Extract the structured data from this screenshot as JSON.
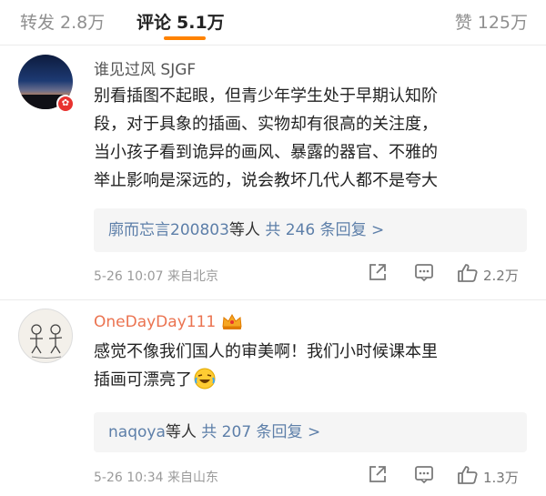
{
  "tabs": {
    "repost": {
      "label": "转发",
      "count": "2.8万"
    },
    "comment": {
      "label": "评论",
      "count": "5.1万"
    },
    "like": {
      "label": "赞",
      "count": "125万"
    }
  },
  "accent_color": "#ff8200",
  "comments": [
    {
      "user": "谁见过风 SJGF",
      "lines": [
        "别看插图不起眼，但青少年学生处于早期认知阶",
        "段，对于具象的插画、实物却有很高的关注度，",
        "当小孩子看到诡异的画风、暴露的器官、不雅的",
        "举止影响是深远的，说会教坏几代人都不是夸大"
      ],
      "replies": {
        "who": "廓而忘言200803",
        "suffix": "等人",
        "total": "共 246 条回复 >"
      },
      "date": "5-26 10:07",
      "source": "来自北京",
      "likes": "2.2万",
      "avatar": "sunset-avatar",
      "badge": "vip-badge"
    },
    {
      "user": "OneDayDay111",
      "lines": [
        "感觉不像我们国人的审美啊！我们小时候课本里",
        "插画可漂亮了"
      ],
      "replies": {
        "who": "naqoya",
        "suffix": "等人",
        "total": "共 207 条回复 >"
      },
      "date": "5-26 10:34",
      "source": "来自山东",
      "likes": "1.3万",
      "avatar": "sketch-avatar",
      "badge": "crown-icon"
    }
  ]
}
